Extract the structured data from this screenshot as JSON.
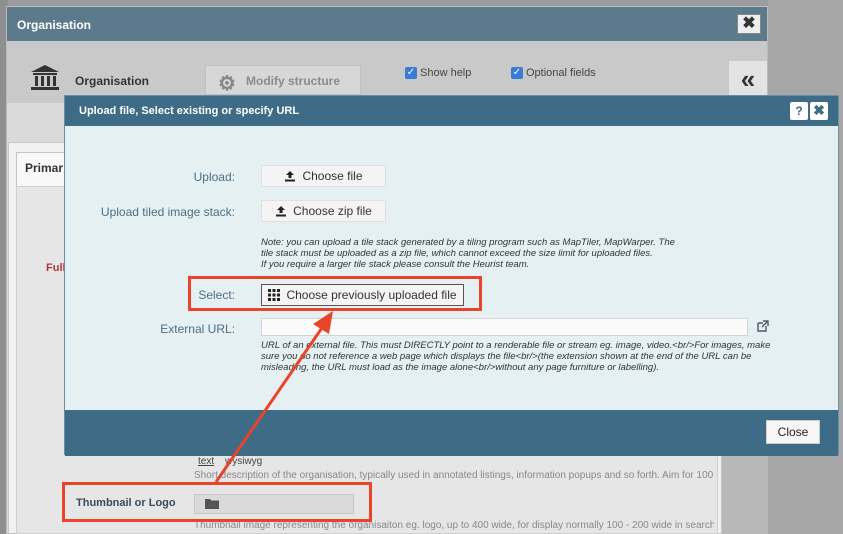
{
  "outer": {
    "title": "Organisation",
    "close_glyph": "✖",
    "record_type": "Organisation",
    "modify_label": "Modify structure",
    "show_help": "Show help",
    "optional_fields": "Optional fields",
    "collapse_glyph": "«"
  },
  "form": {
    "tab_primary": "Primar",
    "full_label": "Full",
    "text_tab": "text",
    "wysiwyg_tab": "wysiwyg",
    "short_desc": "Short description of the organisation, typically used in annotated listings, information popups and so forth. Aim for 100 -",
    "thumb_label": "Thumbnail or Logo",
    "thumb_desc": "Thumbnail image representing the organisaiton eg. logo, up to 400 wide, for display normally 100 - 200 wide in search"
  },
  "dialog": {
    "title": "Upload file, Select existing or specify URL",
    "help_glyph": "?",
    "close_glyph": "✖",
    "upload_label": "Upload:",
    "upload_button": "Choose file",
    "tiled_label": "Upload tiled image stack:",
    "tiled_button": "Choose zip file",
    "tiled_note_1": "Note: you can upload a tile stack generated by a tiling program such as MapTiler, MapWarper. The",
    "tiled_note_2": "tile stack must be uploaded as a zip file, which cannot exceed the size limit for uploaded files.",
    "tiled_note_3": "If you require a larger tile stack please consult the Heurist team.",
    "select_label": "Select:",
    "select_button": "Choose previously uploaded file",
    "url_label": "External URL:",
    "url_value": "",
    "url_note_1": "URL of an external file. This must DIRECTLY point to a renderable file or stream eg. image, video.<br/>For images, make",
    "url_note_2": "sure you do not reference a web page which displays the file<br/>(the extension shown at the end of the URL can be",
    "url_note_3": "misleading, the URL must load as the image alone<br/>without any page furniture or labelling).",
    "close_button": "Close"
  },
  "colors": {
    "title_bar": "#3e6b86",
    "highlight": "#e8442a",
    "dialog_bg": "#e5f0f2"
  }
}
